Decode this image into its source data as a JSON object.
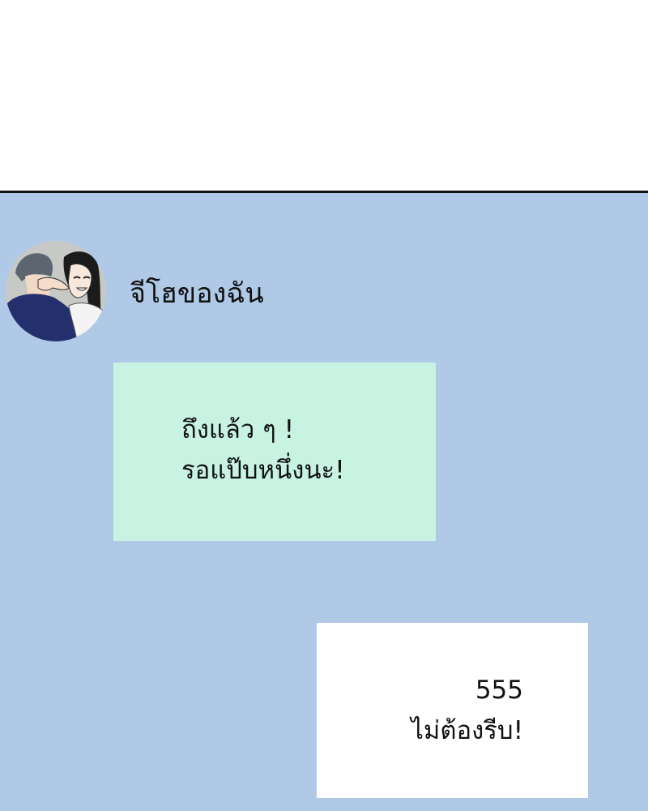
{
  "chat": {
    "contact_name": "จีโฮของฉัน",
    "avatar_icon": "couple-portrait-avatar",
    "background_color": "#afc9e6",
    "messages": [
      {
        "sender": "contact",
        "bubble_color": "#c8f2e2",
        "lines": [
          "ถึงแล้ว ๆ !",
          "รอแป๊บหนึ่งนะ!"
        ]
      },
      {
        "sender": "self",
        "bubble_color": "#ffffff",
        "lines": [
          "555",
          "ไม่ต้องรีบ!"
        ]
      }
    ]
  }
}
